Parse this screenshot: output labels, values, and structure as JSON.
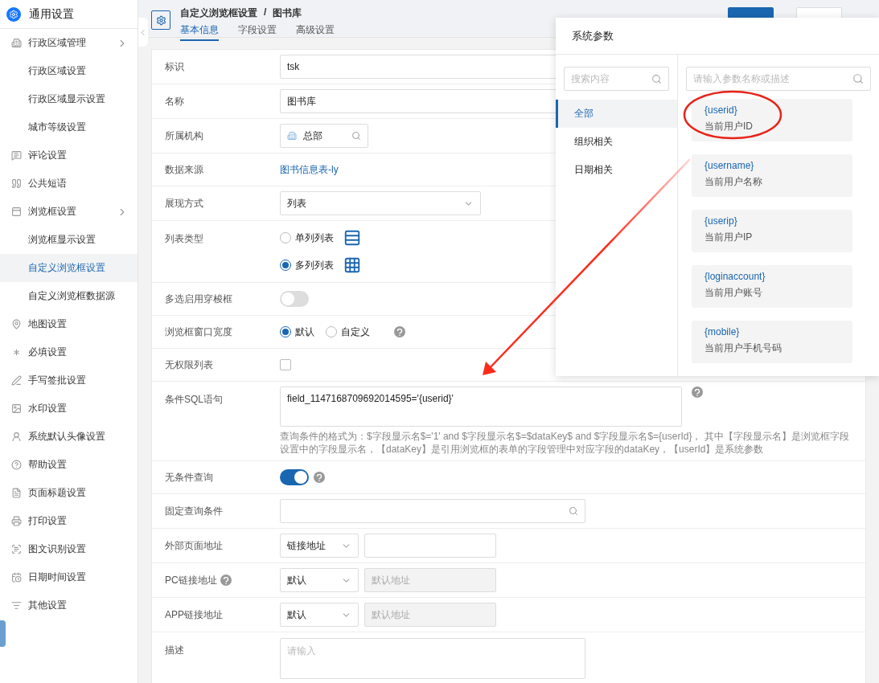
{
  "sidebar": {
    "title": "通用设置",
    "items": [
      {
        "label": "行政区域管理",
        "kind": "group",
        "expanded": true,
        "children": [
          {
            "label": "行政区域设置",
            "selected": false
          },
          {
            "label": "行政区域显示设置",
            "selected": false
          },
          {
            "label": "城市等级设置",
            "selected": false
          }
        ]
      },
      {
        "label": "评论设置",
        "kind": "item"
      },
      {
        "label": "公共短语",
        "kind": "item"
      },
      {
        "label": "浏览框设置",
        "kind": "group",
        "expanded": true,
        "children": [
          {
            "label": "浏览框显示设置",
            "selected": false
          },
          {
            "label": "自定义浏览框设置",
            "selected": true
          },
          {
            "label": "自定义浏览框数据源",
            "selected": false
          }
        ]
      },
      {
        "label": "地图设置",
        "kind": "item"
      },
      {
        "label": "必填设置",
        "kind": "item"
      },
      {
        "label": "手写签批设置",
        "kind": "item"
      },
      {
        "label": "水印设置",
        "kind": "item"
      },
      {
        "label": "系统默认头像设置",
        "kind": "item"
      },
      {
        "label": "帮助设置",
        "kind": "item"
      },
      {
        "label": "页面标题设置",
        "kind": "item"
      },
      {
        "label": "打印设置",
        "kind": "item"
      },
      {
        "label": "图文识别设置",
        "kind": "item"
      },
      {
        "label": "日期时间设置",
        "kind": "item"
      },
      {
        "label": "其他设置",
        "kind": "item"
      }
    ]
  },
  "header": {
    "breadcrumb": [
      "自定义浏览框设置",
      "图书库"
    ],
    "separator": "/",
    "tabs": [
      {
        "label": "基本信息",
        "selected": true
      },
      {
        "label": "字段设置",
        "selected": false
      },
      {
        "label": "高级设置",
        "selected": false
      }
    ],
    "buttons": [
      {
        "kind": "primary"
      },
      {
        "kind": "default"
      }
    ]
  },
  "form": {
    "rows": [
      {
        "label": "标识",
        "kind": "input",
        "value": "tsk"
      },
      {
        "label": "名称",
        "kind": "input",
        "value": "图书库"
      },
      {
        "label": "所属机构",
        "kind": "org",
        "value": "总部"
      },
      {
        "label": "数据来源",
        "kind": "link",
        "value": "图书信息表-ly"
      },
      {
        "label": "展现方式",
        "kind": "select",
        "value": "列表"
      },
      {
        "label": "列表类型",
        "kind": "radio-list",
        "options": [
          {
            "label": "单列列表",
            "selected": false
          },
          {
            "label": "多列列表",
            "selected": true
          }
        ]
      },
      {
        "label": "多选启用穿梭框",
        "kind": "toggle",
        "on": false
      },
      {
        "label": "浏览框窗口宽度",
        "kind": "radio-inline",
        "help": true,
        "options": [
          {
            "label": "默认",
            "selected": true
          },
          {
            "label": "自定义",
            "selected": false
          }
        ]
      },
      {
        "label": "无权限列表",
        "kind": "checkbox",
        "checked": false
      },
      {
        "label": "条件SQL语句",
        "kind": "sql",
        "help": true,
        "value": "field_1147168709692014595='{userid}'",
        "hint": "查询条件的格式为：$字段显示名$='1' and $字段显示名$=$dataKey$ and $字段显示名$={userId}， 其中【字段显示名】是浏览框字段设置中的字段显示名，【dataKey】是引用浏览框的表单的字段管理中对应字段的dataKey，【userId】是系统参数"
      },
      {
        "label": "无条件查询",
        "kind": "toggle",
        "on": true,
        "help": true
      },
      {
        "label": "固定查询条件",
        "kind": "search"
      },
      {
        "label": "外部页面地址",
        "kind": "select-input",
        "select": "链接地址",
        "disabled": false
      },
      {
        "label": "PC链接地址",
        "label_help": true,
        "kind": "select-input",
        "select": "默认",
        "placeholder": "默认地址",
        "disabled": true
      },
      {
        "label": "APP链接地址",
        "kind": "select-input",
        "select": "默认",
        "placeholder": "默认地址",
        "disabled": true
      },
      {
        "label": "描述",
        "kind": "textarea",
        "placeholder": "请输入"
      }
    ]
  },
  "popover": {
    "title": "系统参数",
    "category_search": {
      "placeholder": "搜索内容"
    },
    "categories": [
      {
        "label": "全部",
        "selected": true
      },
      {
        "label": "组织相关",
        "selected": false
      },
      {
        "label": "日期相关",
        "selected": false
      }
    ],
    "param_search": {
      "placeholder": "请输入参数名称或描述"
    },
    "params": [
      {
        "code": "{userid}",
        "desc": "当前用户ID"
      },
      {
        "code": "{username}",
        "desc": "当前用户名称"
      },
      {
        "code": "{userip}",
        "desc": "当前用户IP"
      },
      {
        "code": "{loginaccount}",
        "desc": "当前用户账号"
      },
      {
        "code": "{mobile}",
        "desc": "当前用户手机号码"
      }
    ]
  }
}
